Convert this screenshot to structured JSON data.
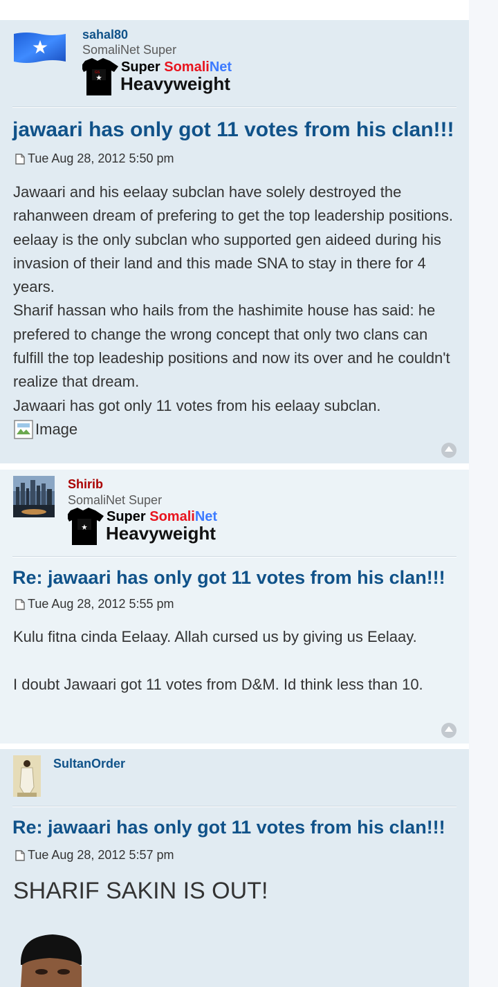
{
  "posts": [
    {
      "username": "sahal80",
      "username_color": "#105289",
      "rank": "SomaliNet Super",
      "badge": {
        "super": "Super",
        "somali": "Somali",
        "net": "Net",
        "heavy": "Heavyweight"
      },
      "title": "jawaari has only got 11 votes from his clan!!!",
      "time": "Tue Aug 28, 2012 5:50 pm",
      "paragraphs": [
        "Jawaari and his eelaay subclan have solely destroyed the rahanween dream of prefering to get the top leadership positions. eelaay is the only subclan who supported gen aideed during his invasion of their land and this made SNA to stay in there for 4 years.",
        "Sharif hassan who hails from the hashimite house has said: he prefered to change the wrong concept that only two clans can fulfill the top leadeship positions and now its over and he couldn't realize that dream.",
        "Jawaari has got only 11 votes from his eelaay subclan."
      ],
      "image_alt": "Image"
    },
    {
      "username": "Shirib",
      "username_color": "#aa0000",
      "rank": "SomaliNet Super",
      "badge": {
        "super": "Super",
        "somali": "Somali",
        "net": "Net",
        "heavy": "Heavyweight"
      },
      "title": "Re: jawaari has only got 11 votes from his clan!!!",
      "time": "Tue Aug 28, 2012 5:55 pm",
      "paragraphs": [
        "Kulu fitna cinda Eelaay. Allah cursed us by giving us Eelaay.",
        "I doubt Jawaari got 11 votes from D&M. Id think less than 10."
      ]
    },
    {
      "username": "SultanOrder",
      "username_color": "#105289",
      "title": "Re: jawaari has only got 11 votes from his clan!!!",
      "time": "Tue Aug 28, 2012 5:57 pm",
      "headline": "SHARIF SAKIN IS OUT!"
    }
  ],
  "colors": {
    "post_bg_1": "#e1ebf2",
    "post_bg_2": "#ecf3f7",
    "link": "#105289"
  }
}
